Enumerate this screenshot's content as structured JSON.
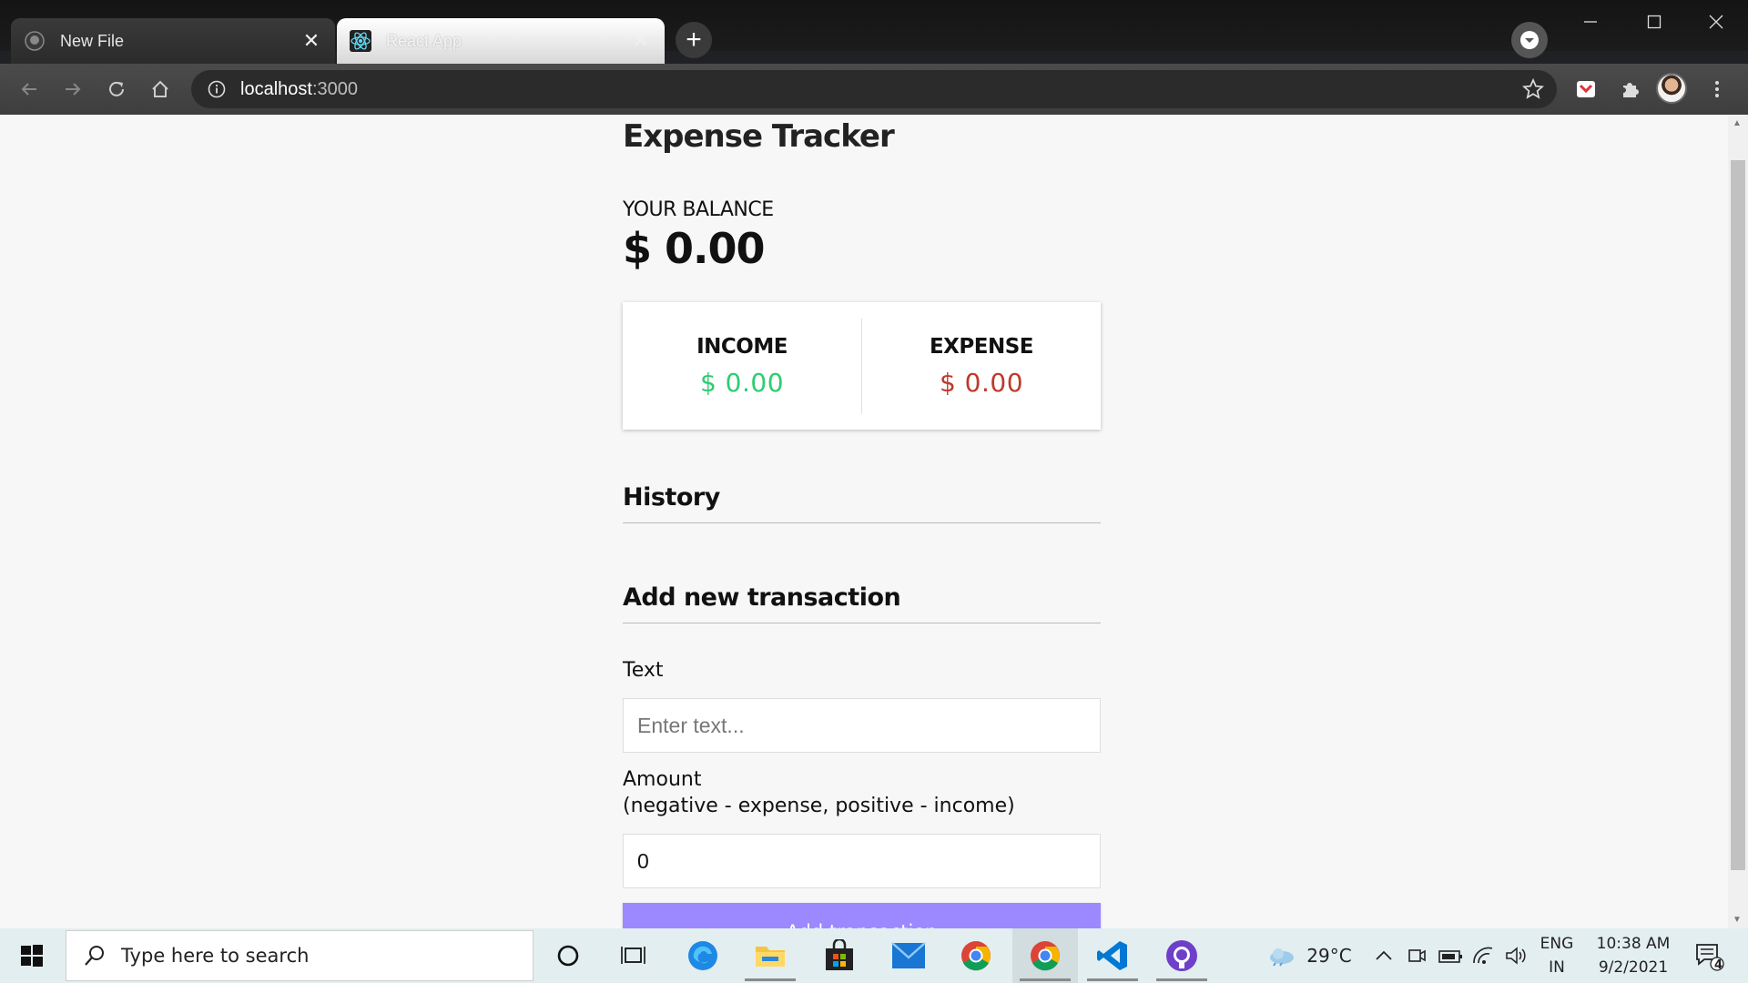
{
  "browser": {
    "tabs": [
      {
        "title": "New File",
        "icon": "github-icon"
      },
      {
        "title": "React App",
        "icon": "react-icon"
      }
    ],
    "address": {
      "host": "localhost",
      "port": ":3000"
    }
  },
  "app": {
    "title": "Expense Tracker",
    "balance_label": "YOUR BALANCE",
    "balance": "$ 0.00",
    "income_label": "INCOME",
    "income": "$ 0.00",
    "expense_label": "EXPENSE",
    "expense": "$ 0.00",
    "history_title": "History",
    "add_title": "Add new transaction",
    "text_label": "Text",
    "text_placeholder": "Enter text...",
    "amount_label": "Amount",
    "amount_hint": "(negative - expense, positive - income)",
    "amount_value": "0",
    "submit_label": "Add transaction",
    "colors": {
      "income": "#2ecc71",
      "expense": "#c0392b",
      "button": "#9c88ff"
    }
  },
  "taskbar": {
    "search_placeholder": "Type here to search",
    "weather": "29°C",
    "lang": "ENG",
    "region": "IN",
    "time": "10:38 AM",
    "date": "9/2/2021",
    "notifications": "4"
  }
}
